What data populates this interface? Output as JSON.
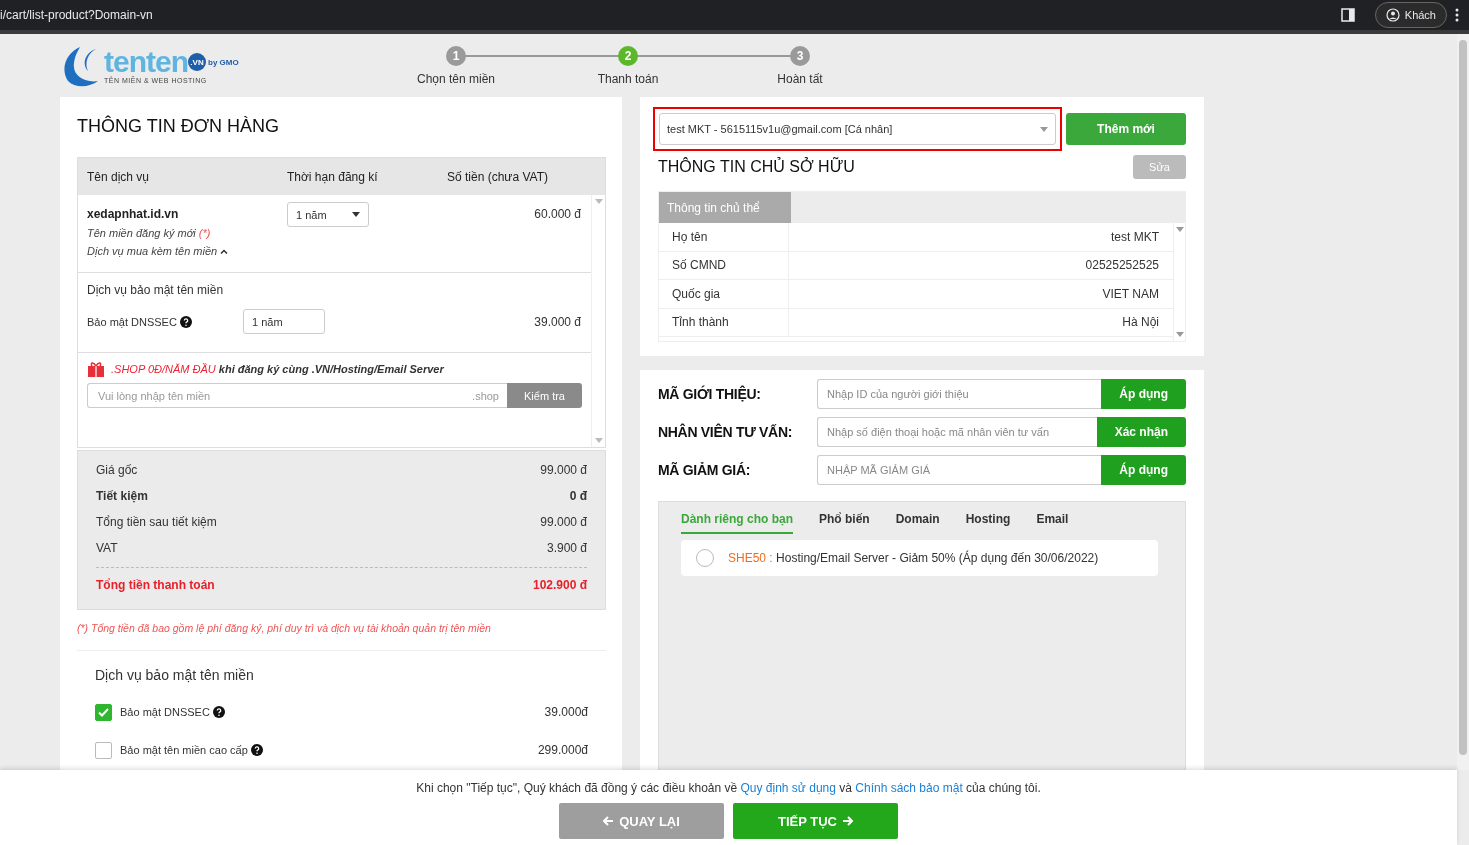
{
  "browser": {
    "url": "i/cart/list-product?Domain-vn",
    "profile": "Khách"
  },
  "logo": {
    "name": "tenten",
    "suffix": ".VN",
    "by": "by GMO",
    "tagline": "TÊN MIỀN & WEB HOSTING"
  },
  "steps": [
    {
      "number": "1",
      "label": "Chọn tên miền",
      "selected": false
    },
    {
      "number": "2",
      "label": "Thanh toán",
      "selected": true
    },
    {
      "number": "3",
      "label": "Hoàn tất",
      "selected": false
    }
  ],
  "order": {
    "title": "THÔNG TIN ĐƠN HÀNG",
    "columns": [
      "Tên dịch vụ",
      "Thời hạn đăng kí",
      "Số tiền (chưa VAT)"
    ],
    "domain": {
      "name": "xedapnhat.id.vn",
      "note": "Tên miền đăng ký mới",
      "note_mark": "(*)",
      "addons_toggle": "Dịch vụ mua kèm tên miền",
      "expanded": true,
      "term": "1 năm",
      "price": "60.000 đ"
    },
    "addon": {
      "group": "Dịch vụ bảo mật tên miền",
      "name": "Bảo mật DNSSEC",
      "term": "1 năm",
      "price": "39.000 đ"
    },
    "promo": {
      "highlight": ".SHOP 0Đ/NĂM ĐẦU",
      "text": "khi đăng ký cùng .VN/Hosting/Email Server",
      "placeholder": "Vui lòng nhập tên miền",
      "suffix": ".shop",
      "button": "Kiểm tra"
    },
    "summary": [
      {
        "label": "Giá gốc",
        "value": "99.000 đ",
        "kind": "normal"
      },
      {
        "label": "Tiết kiệm",
        "value": "0 đ",
        "kind": "bold"
      },
      {
        "label": "Tổng tiền sau tiết kiệm",
        "value": "99.000 đ",
        "kind": "normal"
      },
      {
        "label": "VAT",
        "value": "3.900 đ",
        "kind": "normal"
      },
      {
        "label": "Tổng tiền thanh toán",
        "value": "102.900 đ",
        "kind": "total"
      }
    ],
    "footnote": "(*) Tổng tiền đã bao gồm lệ phí đăng ký, phí duy trì và dịch vụ tài khoản quản trị tên miền"
  },
  "security": {
    "title": "Dịch vụ bảo mật tên miền",
    "options": [
      {
        "label": "Bảo mật DNSSEC",
        "price": "39.000đ",
        "checked": true
      },
      {
        "label": "Bảo mật tên miền cao cấp",
        "price": "299.000đ",
        "checked": false
      }
    ]
  },
  "owner": {
    "select_value": "test MKT - 5615115v1u@gmail.com [Cá nhân]",
    "highlighted": true,
    "add_button": "Thêm mới",
    "title": "THÔNG TIN CHỦ SỞ HỮU",
    "edit_button": "Sửa",
    "tab": "Thông tin chủ thể",
    "rows": [
      {
        "label": "Họ tên",
        "value": "test MKT"
      },
      {
        "label": "Số CMND",
        "value": "02525252525"
      },
      {
        "label": "Quốc gia",
        "value": "VIET NAM"
      },
      {
        "label": "Tỉnh thành",
        "value": "Hà Nội"
      }
    ]
  },
  "codes": [
    {
      "label": "MÃ GIỚI THIỆU:",
      "placeholder": "Nhập ID của người giới thiệu",
      "button": "Áp dụng"
    },
    {
      "label": "NHÂN VIÊN TƯ VẤN:",
      "placeholder": "Nhập số điện thoại hoặc mã nhân viên tư vấn",
      "button": "Xác nhận"
    },
    {
      "label": "MÃ GIẢM GIÁ:",
      "placeholder": "NHẬP MÃ GIẢM GIÁ",
      "button": "Áp dụng"
    }
  ],
  "coupon_tabs": [
    {
      "label": "Dành riêng cho bạn",
      "selected": true
    },
    {
      "label": "Phổ biến",
      "selected": false
    },
    {
      "label": "Domain",
      "selected": false
    },
    {
      "label": "Hosting",
      "selected": false
    },
    {
      "label": "Email",
      "selected": false
    }
  ],
  "coupons": [
    {
      "code": "SHE50 :",
      "text": "Hosting/Email Server - Giảm 50% (Áp dụng đến 30/06/2022)",
      "selected": false
    }
  ],
  "footer": {
    "terms_before": "Khi chọn \"Tiếp tục\", Quý khách đã đồng ý các điều khoản về",
    "link1": "Quy định sử dụng",
    "terms_and": "và",
    "link2": "Chính sách bảo mật",
    "terms_after": "của chúng tôi.",
    "back": "QUAY LẠI",
    "next": "TIẾP TỤC"
  }
}
